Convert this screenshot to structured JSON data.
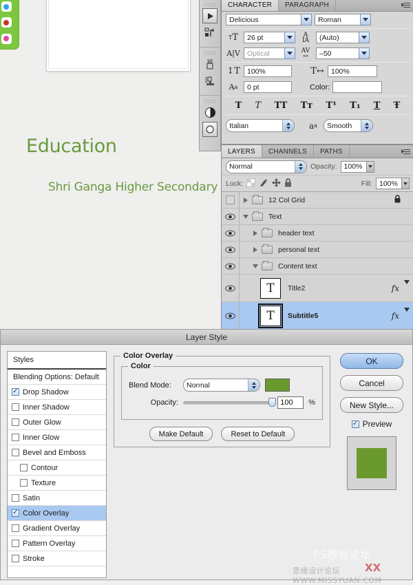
{
  "canvas": {
    "title_text": "Education",
    "subtitle_text": "Shri Ganga Higher Secondary",
    "text_color": "#6a9a3e"
  },
  "icon_dock": {
    "items": [
      {
        "name": "play-button-icon",
        "glyph": "▶"
      },
      {
        "name": "actions-icon",
        "glyph": "⤧"
      },
      {
        "name": "brushes-icon",
        "glyph": "❁"
      },
      {
        "name": "tool-presets-icon",
        "glyph": "☰"
      },
      {
        "name": "adjustments-icon",
        "glyph": "◐"
      },
      {
        "name": "masks-icon",
        "glyph": "◉"
      }
    ]
  },
  "character_panel": {
    "tabs": [
      {
        "label": "CHARACTER",
        "active": true
      },
      {
        "label": "PARAGRAPH",
        "active": false
      }
    ],
    "font_family": "Delicious",
    "font_style": "Roman",
    "font_size_label": "font-size-icon",
    "font_size": "26 pt",
    "leading_label": "leading-icon",
    "leading": "(Auto)",
    "kerning_label": "kerning-icon",
    "kerning": "Optical",
    "tracking_label": "tracking-icon",
    "tracking": "–50",
    "vertical_scale_label": "vertical-scale-icon",
    "vertical_scale": "100%",
    "horizontal_scale_label": "horizontal-scale-icon",
    "horizontal_scale": "100%",
    "baseline_label": "baseline-shift-icon",
    "baseline_shift": "0 pt",
    "color_label": "Color:",
    "color_value": "",
    "style_buttons": [
      {
        "name": "faux-bold",
        "glyph": "T"
      },
      {
        "name": "faux-italic",
        "glyph": "T"
      },
      {
        "name": "all-caps",
        "glyph": "TT"
      },
      {
        "name": "small-caps",
        "glyph": "Tт"
      },
      {
        "name": "superscript",
        "glyph": "T¹"
      },
      {
        "name": "subscript",
        "glyph": "T₁"
      },
      {
        "name": "underline",
        "glyph": "T"
      },
      {
        "name": "strikethrough",
        "glyph": "Ŧ"
      }
    ],
    "language": "Italian",
    "antialias_label": "aa",
    "antialias": "Smooth"
  },
  "layers_panel": {
    "tabs": [
      {
        "label": "LAYERS",
        "active": true
      },
      {
        "label": "CHANNELS",
        "active": false
      },
      {
        "label": "PATHS",
        "active": false
      }
    ],
    "blend_mode": "Normal",
    "opacity_label": "Opacity:",
    "opacity_value": "100%",
    "lock_label": "Lock:",
    "lock_icons": [
      "lock-transparent-icon",
      "lock-image-icon",
      "lock-position-icon",
      "lock-all-icon"
    ],
    "fill_label": "Fill:",
    "fill_value": "100%",
    "layers": [
      {
        "name": "12 Col Grid",
        "type": "group",
        "visible": false,
        "expanded": false,
        "indent": 0,
        "locked": true,
        "selected": false,
        "fx": false
      },
      {
        "name": "Text",
        "type": "group",
        "visible": true,
        "expanded": true,
        "indent": 0,
        "locked": false,
        "selected": false,
        "fx": false
      },
      {
        "name": "header text",
        "type": "group",
        "visible": true,
        "expanded": false,
        "indent": 1,
        "locked": false,
        "selected": false,
        "fx": false
      },
      {
        "name": "personal text",
        "type": "group",
        "visible": true,
        "expanded": false,
        "indent": 1,
        "locked": false,
        "selected": false,
        "fx": false
      },
      {
        "name": "Content text",
        "type": "group",
        "visible": true,
        "expanded": true,
        "indent": 1,
        "locked": false,
        "selected": false,
        "fx": false
      },
      {
        "name": "Title2",
        "type": "text",
        "visible": true,
        "expanded": false,
        "indent": 2,
        "locked": false,
        "selected": false,
        "fx": true
      },
      {
        "name": "Subtitle5",
        "type": "text",
        "visible": true,
        "expanded": false,
        "indent": 2,
        "locked": false,
        "selected": true,
        "fx": true
      }
    ]
  },
  "layer_style_dialog": {
    "title": "Layer Style",
    "styles_header": "Styles",
    "styles_items": [
      {
        "label": "Blending Options: Default",
        "checkbox": false,
        "checked": false,
        "sub": false,
        "selected": false
      },
      {
        "label": "Drop Shadow",
        "checkbox": true,
        "checked": true,
        "sub": false,
        "selected": false
      },
      {
        "label": "Inner Shadow",
        "checkbox": true,
        "checked": false,
        "sub": false,
        "selected": false
      },
      {
        "label": "Outer Glow",
        "checkbox": true,
        "checked": false,
        "sub": false,
        "selected": false
      },
      {
        "label": "Inner Glow",
        "checkbox": true,
        "checked": false,
        "sub": false,
        "selected": false
      },
      {
        "label": "Bevel and Emboss",
        "checkbox": true,
        "checked": false,
        "sub": false,
        "selected": false
      },
      {
        "label": "Contour",
        "checkbox": true,
        "checked": false,
        "sub": true,
        "selected": false
      },
      {
        "label": "Texture",
        "checkbox": true,
        "checked": false,
        "sub": true,
        "selected": false
      },
      {
        "label": "Satin",
        "checkbox": true,
        "checked": false,
        "sub": false,
        "selected": false
      },
      {
        "label": "Color Overlay",
        "checkbox": true,
        "checked": true,
        "sub": false,
        "selected": true
      },
      {
        "label": "Gradient Overlay",
        "checkbox": true,
        "checked": false,
        "sub": false,
        "selected": false
      },
      {
        "label": "Pattern Overlay",
        "checkbox": true,
        "checked": false,
        "sub": false,
        "selected": false
      },
      {
        "label": "Stroke",
        "checkbox": true,
        "checked": false,
        "sub": false,
        "selected": false
      }
    ],
    "section_title": "Color Overlay",
    "group_title": "Color",
    "blend_mode_label": "Blend Mode:",
    "blend_mode_value": "Normal",
    "overlay_color": "#6a9a2e",
    "opacity_label": "Opacity:",
    "opacity_value": "100",
    "opacity_unit": "%",
    "make_default": "Make Default",
    "reset_to_default": "Reset to Default",
    "ok_button": "OK",
    "cancel_button": "Cancel",
    "new_style_button": "New Style...",
    "preview_label": "Preview",
    "preview_checked": true,
    "preview_color": "#6a9a2e"
  },
  "watermarks": {
    "line1": "PS教程论坛",
    "line2": "思缘设计论坛  WWW.MISSYUAN.COM",
    "mark": "XX"
  }
}
